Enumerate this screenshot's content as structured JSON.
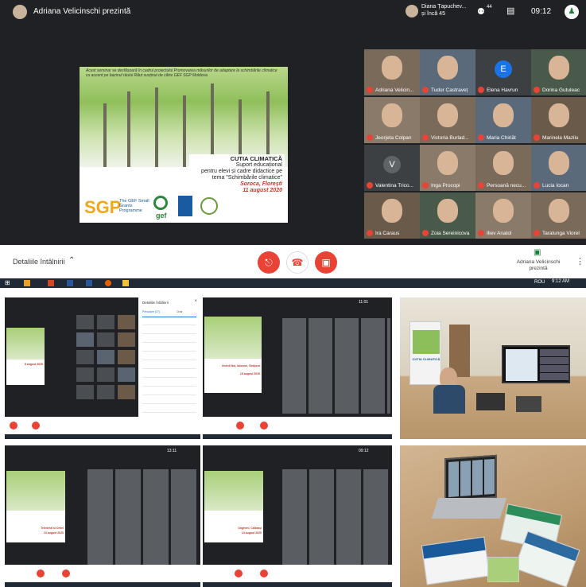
{
  "presenter": {
    "label": "Adriana Velicinschi prezintă"
  },
  "topbar": {
    "participants_name": "Diana Țapuchev...",
    "participants_more": "și încă 45",
    "people_count": "44",
    "time": "09:12"
  },
  "slide": {
    "banner_text": "Acest seminar se desfășoară în cadrul proiectului Promovarea măsurilor de adaptare la schimbările climatice cu accent pe bazinul râului Răut susținut de către GEF SGP Moldova",
    "title": "CUTIA CLIMATICĂ",
    "subtitle_1": "Suport educațional",
    "subtitle_2": "pentru elevi și cadre didactice pe",
    "subtitle_3": "tema \"Schimbările climatice\"",
    "place": "Soroca, Florești",
    "date": "11 august 2020",
    "logo_sgp": "SGP",
    "logo_sgp_text": "The GEF Small Grants Programme",
    "logo_gef": "gef"
  },
  "participants": [
    {
      "name": "Adriana Velicin...",
      "type": "video"
    },
    {
      "name": "Tudor Castraveț",
      "type": "video"
    },
    {
      "name": "Elena Havrun",
      "type": "initial",
      "initial": "E",
      "color": "#1a73e8"
    },
    {
      "name": "Dorina Gutuleac",
      "type": "video"
    },
    {
      "name": "Jeorjeta Colpan",
      "type": "video"
    },
    {
      "name": "Victoria Burlad...",
      "type": "video"
    },
    {
      "name": "Maria Chiriăt",
      "type": "video"
    },
    {
      "name": "Marinela Mazilu",
      "type": "video"
    },
    {
      "name": "Valentina Trico...",
      "type": "initial",
      "initial": "V",
      "color": "#5f6368"
    },
    {
      "name": "Inga Procopi",
      "type": "video"
    },
    {
      "name": "Persoană necu...",
      "type": "video"
    },
    {
      "name": "Lucia Iocan",
      "type": "video"
    },
    {
      "name": "Ira Caraus",
      "type": "video"
    },
    {
      "name": "Zoia Sereinicova",
      "type": "video"
    },
    {
      "name": "Iliev Anatol",
      "type": "video"
    },
    {
      "name": "Taralunga Viorel",
      "type": "video"
    }
  ],
  "controls": {
    "meeting_details": "Detaliile întâlnirii",
    "presenting_label": "Adriana Velicinschi prezintă"
  },
  "taskbar": {
    "lang": "ROU",
    "time": "9:12 AM"
  },
  "thumbs": {
    "panel_title": "Detaliile întâlnirii",
    "panel_tab_people": "Persoane (37)",
    "panel_tab_chat": "Chat",
    "t2_place": "Anenii Noi, Ialoveni, Străşeni",
    "t2_date": "18 august 2020",
    "t1_date": "8 august 2020",
    "t4_place": "Telenesti și Orhei",
    "t4_date": "13 august 2020",
    "t5_place": "Ungheni, Călăraşi",
    "t5_date": "14 august 2020",
    "t2_time": "11:01",
    "t4_time": "13:11",
    "t5_time": "09:12",
    "photo_title": "CUTIA CLIMATICĂ"
  }
}
